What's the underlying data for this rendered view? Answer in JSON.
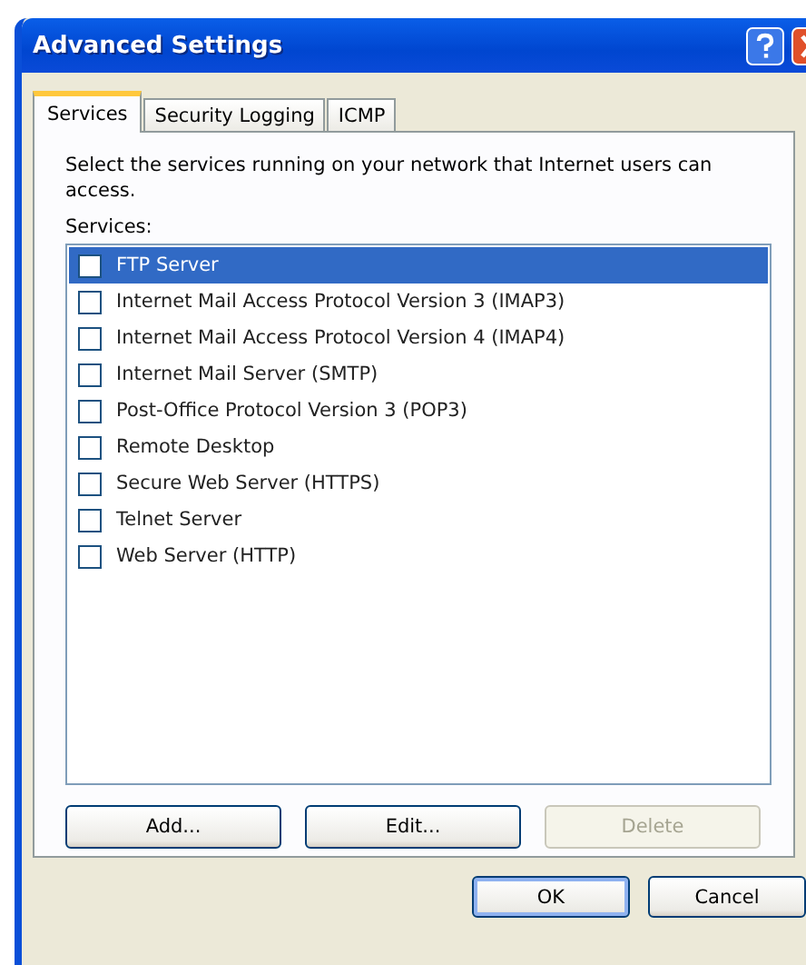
{
  "window": {
    "title": "Advanced Settings"
  },
  "tabs": [
    {
      "label": "Services",
      "selected": true
    },
    {
      "label": "Security Logging",
      "selected": false
    },
    {
      "label": "ICMP",
      "selected": false
    }
  ],
  "description": "Select the services running on your network that Internet users can access.",
  "services_label": "Services:",
  "services": [
    {
      "name": "FTP Server",
      "checked": false,
      "selected": true
    },
    {
      "name": "Internet Mail Access Protocol Version 3 (IMAP3)",
      "checked": false,
      "selected": false
    },
    {
      "name": "Internet Mail Access Protocol Version 4 (IMAP4)",
      "checked": false,
      "selected": false
    },
    {
      "name": "Internet Mail Server (SMTP)",
      "checked": false,
      "selected": false
    },
    {
      "name": "Post-Office Protocol Version 3 (POP3)",
      "checked": false,
      "selected": false
    },
    {
      "name": "Remote Desktop",
      "checked": false,
      "selected": false
    },
    {
      "name": "Secure Web Server (HTTPS)",
      "checked": false,
      "selected": false
    },
    {
      "name": "Telnet Server",
      "checked": false,
      "selected": false
    },
    {
      "name": "Web Server (HTTP)",
      "checked": false,
      "selected": false
    }
  ],
  "list_buttons": [
    {
      "label": "Add...",
      "disabled": false
    },
    {
      "label": "Edit...",
      "disabled": false
    },
    {
      "label": "Delete",
      "disabled": true
    }
  ],
  "dialog_buttons": [
    {
      "label": "OK"
    },
    {
      "label": "Cancel"
    }
  ]
}
